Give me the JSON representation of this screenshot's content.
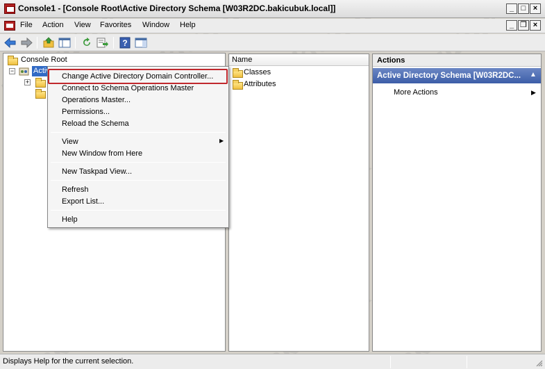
{
  "window": {
    "title": "Console1 - [Console Root\\Active Directory Schema [W03R2DC.bakicubuk.local]]",
    "min_glyph": "_",
    "max_glyph": "□",
    "close_glyph": "×",
    "restore_glyph": "❐"
  },
  "menu": [
    "File",
    "Action",
    "View",
    "Favorites",
    "Window",
    "Help"
  ],
  "toolbar_icons": [
    "back-icon",
    "forward-icon",
    "up-folder-icon",
    "show-hide-tree-icon",
    "refresh-icon",
    "export-list-icon",
    "help-icon",
    "show-hide-action-pane-icon"
  ],
  "tree": {
    "root": "Console Root",
    "selected_node_visible": "Activ",
    "child_collapsed_glyph": "+",
    "child_open_glyph": "−"
  },
  "list": {
    "header": "Name",
    "items": [
      "Classes",
      "Attributes"
    ]
  },
  "actions": {
    "header": "Actions",
    "section_title": "Active Directory Schema [W03R2DC...",
    "section_chevron": "▲",
    "more_actions": "More Actions",
    "more_arrow": "▶"
  },
  "context_menu": {
    "items": [
      "Change Active Directory Domain Controller...",
      "Connect to Schema Operations Master",
      "Operations Master...",
      "Permissions...",
      "Reload the Schema",
      "View",
      "New Window from Here",
      "New Taskpad View...",
      "Refresh",
      "Export List...",
      "Help"
    ],
    "submenu_arrow": "▶"
  },
  "status": {
    "text": "Displays Help for the current selection."
  },
  "watermark": "bakicubuk",
  "colors": {
    "highlight_box": "#c0282d",
    "actions_section": "#3c5da8",
    "selection": "#316ac5"
  }
}
